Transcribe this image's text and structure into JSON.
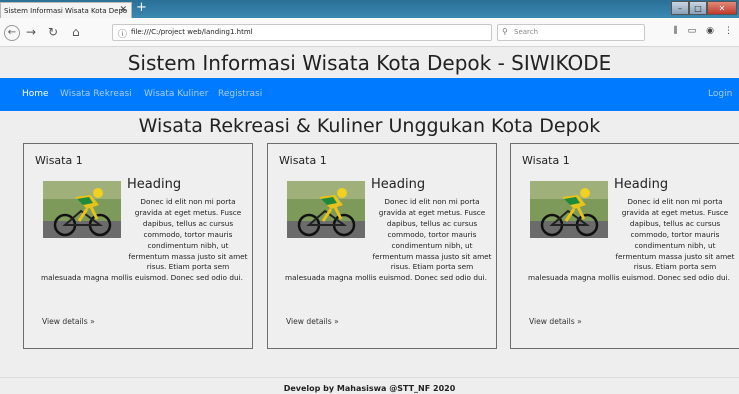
{
  "browser": {
    "tab_title": "Sistem Informasi Wisata Kota Depo",
    "new_tab": "+",
    "url": "file:///C:/project web/landing1.html",
    "search_placeholder": "Search"
  },
  "site": {
    "title": "Sistem Informasi Wisata Kota Depok - SIWIKODE",
    "menu": {
      "home": "Home",
      "wisata_rekreasi": "Wisata Rekreasi",
      "wisata_kuliner": "Wisata Kuliner",
      "registrasi": "Registrasi",
      "login": "Login"
    },
    "section_heading": "Wisata Rekreasi & Kuliner Unggukan Kota Depok",
    "footer": "Develop by Mahasiswa @STT_NF 2020"
  },
  "cards": [
    {
      "title": "Wisata 1",
      "heading": "Heading",
      "text": "Donec id elit non mi porta gravida at eget metus. Fusce dapibus, tellus ac cursus commodo, tortor mauris condimentum nibh, ut fermentum massa justo sit amet risus. Etiam porta sem malesuada magna mollis euismod. Donec sed odio dui.",
      "link": "View details »"
    },
    {
      "title": "Wisata 1",
      "heading": "Heading",
      "text": "Donec id elit non mi porta gravida at eget metus. Fusce dapibus, tellus ac cursus commodo, tortor mauris condimentum nibh, ut fermentum massa justo sit amet risus. Etiam porta sem malesuada magna mollis euismod. Donec sed odio dui.",
      "link": "View details »"
    },
    {
      "title": "Wisata 1",
      "heading": "Heading",
      "text": "Donec id elit non mi porta gravida at eget metus. Fusce dapibus, tellus ac cursus commodo, tortor mauris condimentum nibh, ut fermentum massa justo sit amet risus. Etiam porta sem malesuada magna mollis euismod. Donec sed odio dui.",
      "link": "View details »"
    }
  ],
  "colors": {
    "navbar": "#007bff",
    "page_bg": "#eeeeee"
  }
}
